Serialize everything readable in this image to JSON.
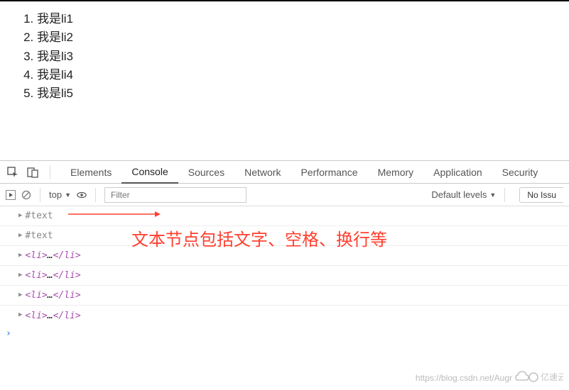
{
  "list_items": [
    "我是li1",
    "我是li2",
    "我是li3",
    "我是li4",
    "我是li5"
  ],
  "devtools": {
    "tabs": [
      "Elements",
      "Console",
      "Sources",
      "Network",
      "Performance",
      "Memory",
      "Application",
      "Security"
    ],
    "active_tab": "Console",
    "context": "top",
    "filter_placeholder": "Filter",
    "levels_label": "Default levels",
    "no_issues": "No Issu"
  },
  "console_rows": [
    {
      "type": "text",
      "label": "#text"
    },
    {
      "type": "text",
      "label": "#text"
    },
    {
      "type": "li"
    },
    {
      "type": "li"
    },
    {
      "type": "li"
    },
    {
      "type": "li"
    }
  ],
  "li_tag": {
    "open": "<li>",
    "ell": "…",
    "close": "</li>"
  },
  "annotation": "文本节点包括文字、空格、换行等",
  "watermark_url": "https://blog.csdn.net/Augr",
  "watermark_brand": "亿速云"
}
